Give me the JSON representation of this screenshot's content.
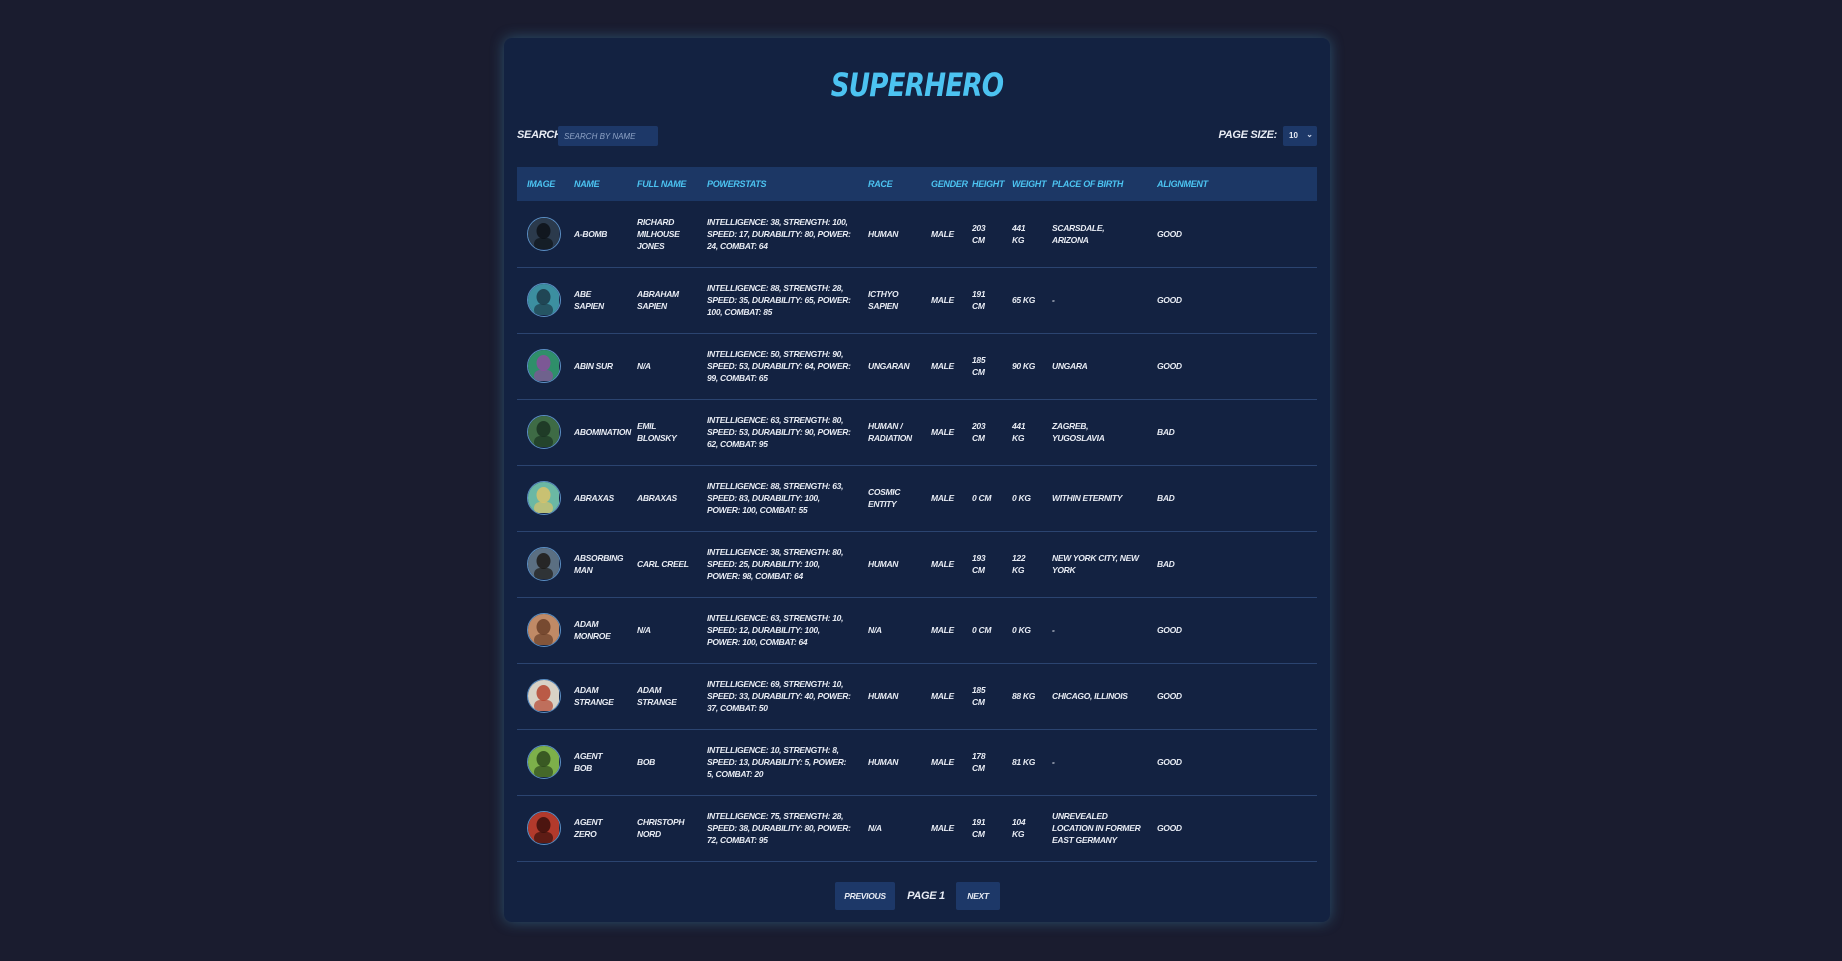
{
  "page": {
    "title": "Superhero"
  },
  "controls": {
    "search_label": "Search:",
    "search_placeholder": "Search by name",
    "search_value": "",
    "page_size_label": "Page Size:",
    "page_size_value": "10"
  },
  "table": {
    "columns": [
      "Image",
      "Name",
      "Full Name",
      "Powerstats",
      "Race",
      "Gender",
      "Height",
      "Weight",
      "Place of Birth",
      "Alignment"
    ],
    "rows": [
      {
        "name": "A-Bomb",
        "full_name": "Richard Milhouse Jones",
        "powerstats": "Intelligence: 38, Strength: 100, Speed: 17, Durability: 80, Power: 24, Combat: 64",
        "race": "Human",
        "gender": "Male",
        "height": "203 cm",
        "weight": "441 kg",
        "place_of_birth": "Scarsdale, Arizona",
        "alignment": "good",
        "avatar_color": "#2b3a4c",
        "avatar_accent": "#0d1218"
      },
      {
        "name": "Abe Sapien",
        "full_name": "Abraham Sapien",
        "powerstats": "Intelligence: 88, Strength: 28, Speed: 35, Durability: 65, Power: 100, Combat: 85",
        "race": "Icthyo Sapien",
        "gender": "Male",
        "height": "191 cm",
        "weight": "65 kg",
        "place_of_birth": "-",
        "alignment": "good",
        "avatar_color": "#3c8fa0",
        "avatar_accent": "#1b3a48"
      },
      {
        "name": "Abin Sur",
        "full_name": "N/A",
        "powerstats": "Intelligence: 50, Strength: 90, Speed: 53, Durability: 64, Power: 99, Combat: 65",
        "race": "Ungaran",
        "gender": "Male",
        "height": "185 cm",
        "weight": "90 kg",
        "place_of_birth": "Ungara",
        "alignment": "good",
        "avatar_color": "#2f8f6a",
        "avatar_accent": "#8a4f9c"
      },
      {
        "name": "Abomination",
        "full_name": "Emil Blonsky",
        "powerstats": "Intelligence: 63, Strength: 80, Speed: 53, Durability: 90, Power: 62, Combat: 95",
        "race": "Human / Radiation",
        "gender": "Male",
        "height": "203 cm",
        "weight": "441 kg",
        "place_of_birth": "Zagreb, Yugoslavia",
        "alignment": "bad",
        "avatar_color": "#3e6b45",
        "avatar_accent": "#1a3322"
      },
      {
        "name": "Abraxas",
        "full_name": "Abraxas",
        "powerstats": "Intelligence: 88, Strength: 63, Speed: 83, Durability: 100, Power: 100, Combat: 55",
        "race": "Cosmic Entity",
        "gender": "Male",
        "height": "0 cm",
        "weight": "0 kg",
        "place_of_birth": "Within Eternity",
        "alignment": "bad",
        "avatar_color": "#6bb8a4",
        "avatar_accent": "#d9c26a"
      },
      {
        "name": "Absorbing Man",
        "full_name": "Carl Creel",
        "powerstats": "Intelligence: 38, Strength: 80, Speed: 25, Durability: 100, Power: 98, Combat: 64",
        "race": "Human",
        "gender": "Male",
        "height": "193 cm",
        "weight": "122 kg",
        "place_of_birth": "New York City, New York",
        "alignment": "bad",
        "avatar_color": "#5b6f82",
        "avatar_accent": "#1d1a16"
      },
      {
        "name": "Adam Monroe",
        "full_name": "N/A",
        "powerstats": "Intelligence: 63, Strength: 10, Speed: 12, Durability: 100, Power: 100, Combat: 64",
        "race": "N/A",
        "gender": "Male",
        "height": "0 cm",
        "weight": "0 kg",
        "place_of_birth": "-",
        "alignment": "good",
        "avatar_color": "#c08a66",
        "avatar_accent": "#6a3e28"
      },
      {
        "name": "Adam Strange",
        "full_name": "Adam Strange",
        "powerstats": "Intelligence: 69, Strength: 10, Speed: 33, Durability: 40, Power: 37, Combat: 50",
        "race": "Human",
        "gender": "Male",
        "height": "185 cm",
        "weight": "88 kg",
        "place_of_birth": "Chicago, Illinois",
        "alignment": "good",
        "avatar_color": "#d8d2c6",
        "avatar_accent": "#b5452f"
      },
      {
        "name": "Agent Bob",
        "full_name": "Bob",
        "powerstats": "Intelligence: 10, Strength: 8, Speed: 13, Durability: 5, Power: 5, Combat: 20",
        "race": "Human",
        "gender": "Male",
        "height": "178 cm",
        "weight": "81 kg",
        "place_of_birth": "-",
        "alignment": "good",
        "avatar_color": "#7db04a",
        "avatar_accent": "#2d4a1c"
      },
      {
        "name": "Agent Zero",
        "full_name": "Christoph Nord",
        "powerstats": "Intelligence: 75, Strength: 28, Speed: 38, Durability: 80, Power: 72, Combat: 95",
        "race": "N/A",
        "gender": "Male",
        "height": "191 cm",
        "weight": "104 kg",
        "place_of_birth": "Unrevealed location in former East Germany",
        "alignment": "good",
        "avatar_color": "#b23a2c",
        "avatar_accent": "#3a0f0c"
      }
    ]
  },
  "pagination": {
    "previous_label": "Previous",
    "page_label": "Page 1",
    "next_label": "Next"
  }
}
